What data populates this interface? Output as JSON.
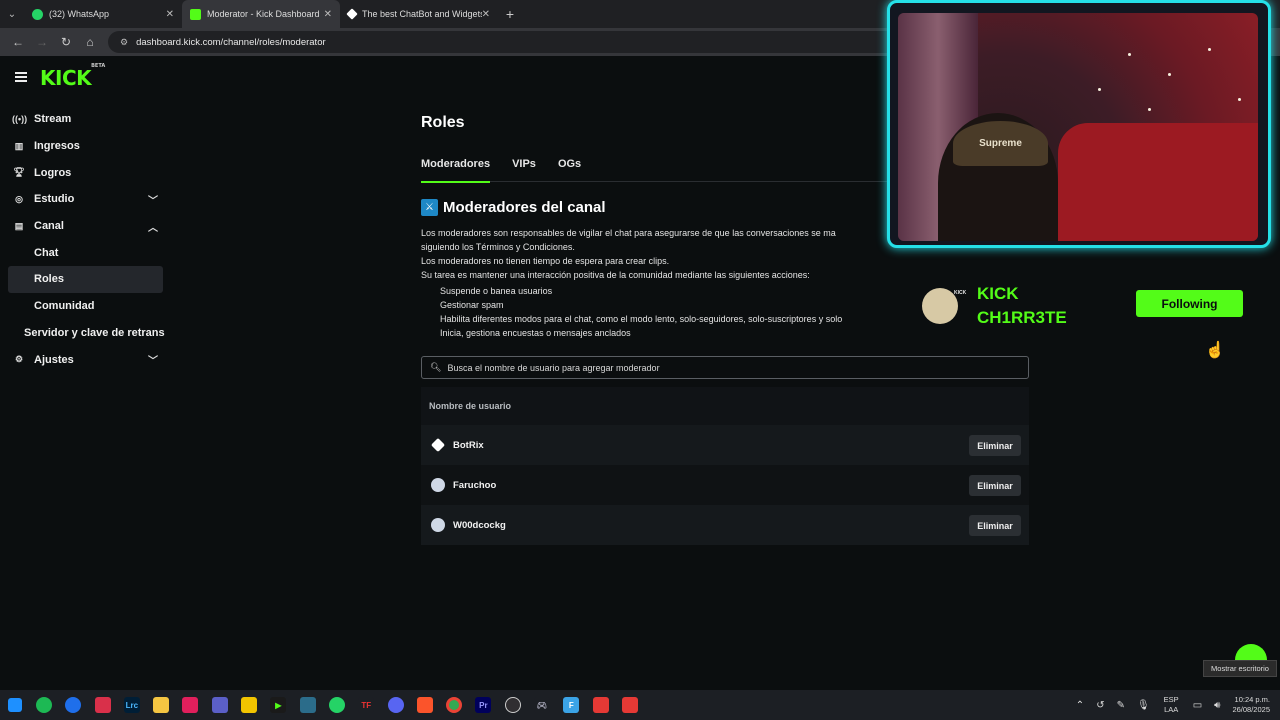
{
  "browser": {
    "tabs": [
      {
        "title": "(32) WhatsApp",
        "favicon_color": "#25d366"
      },
      {
        "title": "Moderator - Kick Dashboard",
        "favicon_color": "#53fc18"
      },
      {
        "title": "The best ChatBot and Widgets",
        "favicon_color": "#ffffff"
      }
    ],
    "url": "dashboard.kick.com/channel/roles/moderator"
  },
  "logo": {
    "text": "KICK",
    "badge": "BETA"
  },
  "sidebar": {
    "items": [
      {
        "label": "Stream",
        "icon": "broadcast-icon"
      },
      {
        "label": "Ingresos",
        "icon": "chart-icon"
      },
      {
        "label": "Logros",
        "icon": "trophy-icon"
      },
      {
        "label": "Estudio",
        "icon": "studio-icon",
        "chevron": "down"
      },
      {
        "label": "Canal",
        "icon": "channel-icon",
        "chevron": "up"
      },
      {
        "label": "Chat"
      },
      {
        "label": "Roles"
      },
      {
        "label": "Comunidad"
      },
      {
        "label": "Servidor y clave de retrans"
      },
      {
        "label": "Ajustes",
        "icon": "gear-icon",
        "chevron": "down"
      }
    ]
  },
  "main": {
    "title": "Roles",
    "tabs": [
      "Moderadores",
      "VIPs",
      "OGs"
    ],
    "section_title": "Moderadores del canal",
    "description": [
      "Los moderadores son responsables de vigilar el chat para asegurarse de que las conversaciones se ma",
      "siguiendo los Términos y Condiciones.",
      "Los moderadores no tienen tiempo de espera para crear clips.",
      "Su tarea es mantener una interacción positiva de la comunidad mediante las siguientes acciones:"
    ],
    "bullets": [
      "Suspende o banea usuarios",
      "Gestionar spam",
      "Habilita diferentes modos para el chat, como el modo lento, solo-seguidores, solo-suscriptores y solo",
      "Inicia, gestiona encuestas o mensajes anclados"
    ],
    "search_placeholder": "Busca el nombre de usuario para agregar moderador",
    "table_header": "Nombre de usuario",
    "moderators": [
      {
        "name": "BotRix",
        "action": "Eliminar"
      },
      {
        "name": "Faruchoo",
        "action": "Eliminar"
      },
      {
        "name": "W00dcockg",
        "action": "Eliminar"
      }
    ]
  },
  "overlay": {
    "cap_text": "Supreme",
    "follow": {
      "kick_tag": "KICK",
      "name_line1": "KICK",
      "name_line2": "CH1RR3TE",
      "button": "Following"
    }
  },
  "tooltip": "Mostrar escritorio",
  "taskbar": {
    "lang_line1": "ESP",
    "lang_line2": "LAA",
    "time": "10:24 p.m.",
    "date": "26/08/2025"
  }
}
